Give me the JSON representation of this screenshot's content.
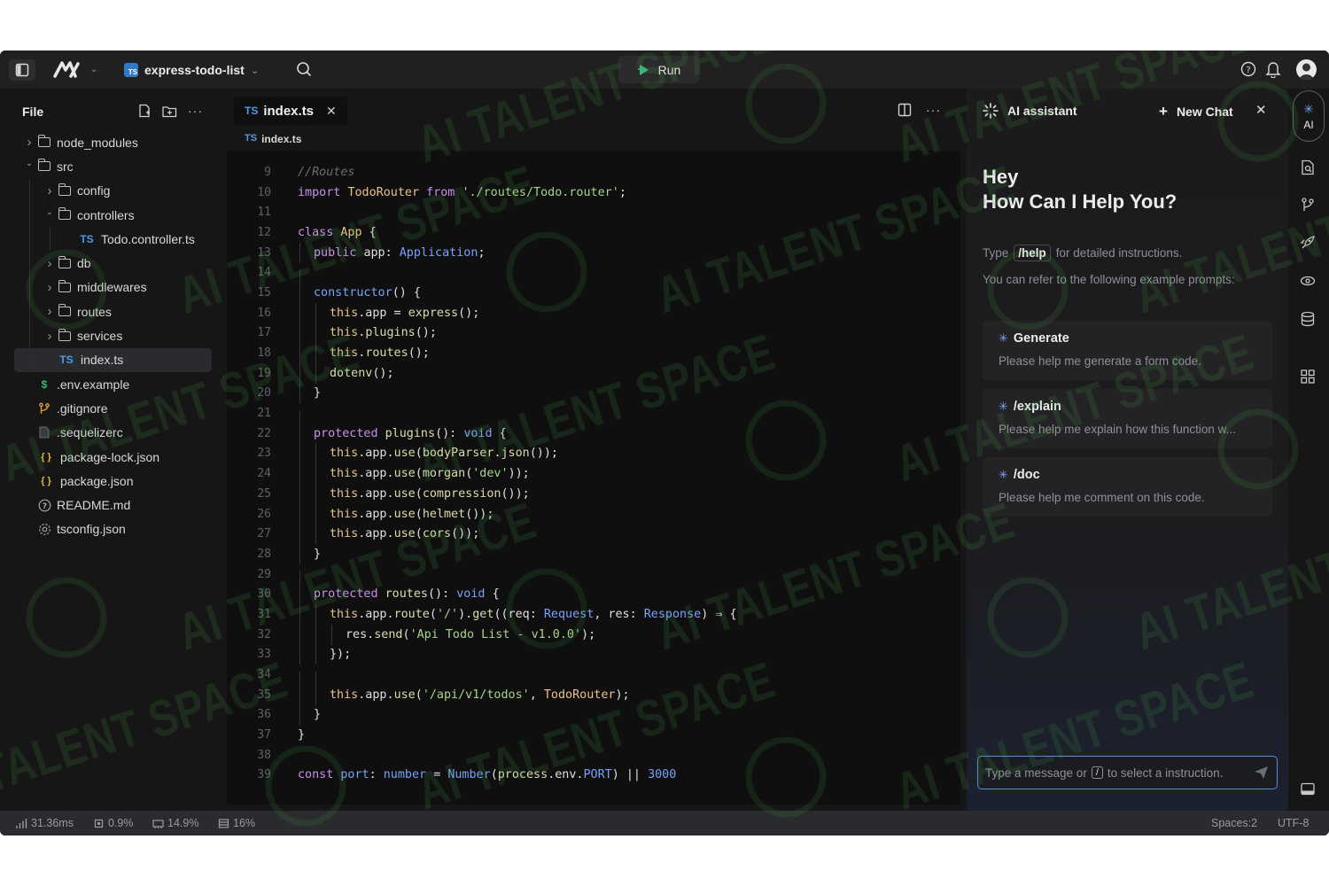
{
  "topbar": {
    "project_name": "express-todo-list",
    "run_label": "Run"
  },
  "explorer": {
    "title": "File",
    "tree": [
      {
        "label": "node_modules",
        "type": "folder",
        "depth": 0,
        "expanded": false
      },
      {
        "label": "src",
        "type": "folder",
        "depth": 0,
        "expanded": true
      },
      {
        "label": "config",
        "type": "folder",
        "depth": 1,
        "expanded": false
      },
      {
        "label": "controllers",
        "type": "folder",
        "depth": 1,
        "expanded": true
      },
      {
        "label": "Todo.controller.ts",
        "type": "ts",
        "depth": 2
      },
      {
        "label": "db",
        "type": "folder",
        "depth": 1,
        "expanded": false
      },
      {
        "label": "middlewares",
        "type": "folder",
        "depth": 1,
        "expanded": false
      },
      {
        "label": "routes",
        "type": "folder",
        "depth": 1,
        "expanded": false
      },
      {
        "label": "services",
        "type": "folder",
        "depth": 1,
        "expanded": false
      },
      {
        "label": "index.ts",
        "type": "ts",
        "depth": 1,
        "selected": true
      },
      {
        "label": ".env.example",
        "type": "env",
        "depth": 0
      },
      {
        "label": ".gitignore",
        "type": "git",
        "depth": 0
      },
      {
        "label": ".sequelizerc",
        "type": "file",
        "depth": 0
      },
      {
        "label": "package-lock.json",
        "type": "json",
        "depth": 0
      },
      {
        "label": "package.json",
        "type": "json",
        "depth": 0
      },
      {
        "label": "README.md",
        "type": "readme",
        "depth": 0
      },
      {
        "label": "tsconfig.json",
        "type": "config",
        "depth": 0
      }
    ]
  },
  "editor": {
    "tab": {
      "badge": "TS",
      "label": "index.ts"
    },
    "breadcrumb": {
      "badge": "TS",
      "label": "index.ts"
    },
    "lines": [
      {
        "n": "9",
        "indent": 0,
        "tokens": [
          [
            "cm",
            "//Routes"
          ]
        ]
      },
      {
        "n": "10",
        "indent": 0,
        "tokens": [
          [
            "kw",
            "import "
          ],
          [
            "cls",
            "TodoRouter "
          ],
          [
            "kw",
            "from "
          ],
          [
            "st",
            "'./routes/Todo.router'"
          ],
          [
            "pr",
            ";"
          ]
        ]
      },
      {
        "n": "11",
        "indent": 0,
        "tokens": []
      },
      {
        "n": "12",
        "indent": 0,
        "tokens": [
          [
            "kw",
            "class "
          ],
          [
            "cls",
            "App "
          ],
          [
            "pr",
            "{"
          ]
        ]
      },
      {
        "n": "13",
        "indent": 1,
        "tokens": [
          [
            "kw",
            "public "
          ],
          [
            "pr",
            "app: "
          ],
          [
            "ty",
            "Application"
          ],
          [
            "pr",
            ";"
          ]
        ]
      },
      {
        "n": "14",
        "indent": 1,
        "tokens": []
      },
      {
        "n": "15",
        "indent": 1,
        "tokens": [
          [
            "nm",
            "constructor"
          ],
          [
            "pr",
            "() {"
          ]
        ]
      },
      {
        "n": "16",
        "indent": 2,
        "tokens": [
          [
            "th",
            "this"
          ],
          [
            "pr",
            ".app = "
          ],
          [
            "fn",
            "express"
          ],
          [
            "pr",
            "();"
          ]
        ]
      },
      {
        "n": "17",
        "indent": 2,
        "tokens": [
          [
            "th",
            "this"
          ],
          [
            "pr",
            "."
          ],
          [
            "fn",
            "plugins"
          ],
          [
            "pr",
            "();"
          ]
        ]
      },
      {
        "n": "18",
        "indent": 2,
        "tokens": [
          [
            "th",
            "this"
          ],
          [
            "pr",
            "."
          ],
          [
            "fn",
            "routes"
          ],
          [
            "pr",
            "();"
          ]
        ]
      },
      {
        "n": "19",
        "indent": 2,
        "tokens": [
          [
            "fn",
            "dotenv"
          ],
          [
            "pr",
            "();"
          ]
        ]
      },
      {
        "n": "20",
        "indent": 1,
        "tokens": [
          [
            "pr",
            "}"
          ]
        ]
      },
      {
        "n": "21",
        "indent": 1,
        "tokens": []
      },
      {
        "n": "22",
        "indent": 1,
        "tokens": [
          [
            "kw",
            "protected "
          ],
          [
            "fn",
            "plugins"
          ],
          [
            "pr",
            "(): "
          ],
          [
            "ty",
            "void "
          ],
          [
            "pr",
            "{"
          ]
        ]
      },
      {
        "n": "23",
        "indent": 2,
        "tokens": [
          [
            "th",
            "this"
          ],
          [
            "pr",
            ".app."
          ],
          [
            "fn",
            "use"
          ],
          [
            "pr",
            "("
          ],
          [
            "fn",
            "bodyParser"
          ],
          [
            "pr",
            "."
          ],
          [
            "fn",
            "json"
          ],
          [
            "pr",
            "());"
          ]
        ]
      },
      {
        "n": "24",
        "indent": 2,
        "tokens": [
          [
            "th",
            "this"
          ],
          [
            "pr",
            ".app."
          ],
          [
            "fn",
            "use"
          ],
          [
            "pr",
            "("
          ],
          [
            "fn",
            "morgan"
          ],
          [
            "pr",
            "("
          ],
          [
            "st",
            "'dev'"
          ],
          [
            "pr",
            "));"
          ]
        ]
      },
      {
        "n": "25",
        "indent": 2,
        "tokens": [
          [
            "th",
            "this"
          ],
          [
            "pr",
            ".app."
          ],
          [
            "fn",
            "use"
          ],
          [
            "pr",
            "("
          ],
          [
            "fn",
            "compression"
          ],
          [
            "pr",
            "());"
          ]
        ]
      },
      {
        "n": "26",
        "indent": 2,
        "tokens": [
          [
            "th",
            "this"
          ],
          [
            "pr",
            ".app."
          ],
          [
            "fn",
            "use"
          ],
          [
            "pr",
            "("
          ],
          [
            "fn",
            "helmet"
          ],
          [
            "pr",
            "());"
          ]
        ]
      },
      {
        "n": "27",
        "indent": 2,
        "tokens": [
          [
            "th",
            "this"
          ],
          [
            "pr",
            ".app."
          ],
          [
            "fn",
            "use"
          ],
          [
            "pr",
            "("
          ],
          [
            "fn",
            "cors"
          ],
          [
            "pr",
            "());"
          ]
        ]
      },
      {
        "n": "28",
        "indent": 1,
        "tokens": [
          [
            "pr",
            "}"
          ]
        ]
      },
      {
        "n": "29",
        "indent": 1,
        "tokens": []
      },
      {
        "n": "30",
        "indent": 1,
        "tokens": [
          [
            "kw",
            "protected "
          ],
          [
            "fn",
            "routes"
          ],
          [
            "pr",
            "(): "
          ],
          [
            "ty",
            "void "
          ],
          [
            "pr",
            "{"
          ]
        ]
      },
      {
        "n": "31",
        "indent": 2,
        "tokens": [
          [
            "th",
            "this"
          ],
          [
            "pr",
            ".app."
          ],
          [
            "fn",
            "route"
          ],
          [
            "pr",
            "("
          ],
          [
            "st",
            "'/'"
          ],
          [
            "pr",
            ")."
          ],
          [
            "fn",
            "get"
          ],
          [
            "pr",
            "((req: "
          ],
          [
            "ty",
            "Request"
          ],
          [
            "pr",
            ", res: "
          ],
          [
            "ty",
            "Response"
          ],
          [
            "pr",
            ") ⇒ {"
          ]
        ]
      },
      {
        "n": "32",
        "indent": 3,
        "tokens": [
          [
            "pr",
            "res."
          ],
          [
            "fn",
            "send"
          ],
          [
            "pr",
            "("
          ],
          [
            "st",
            "'Api Todo List - v1.0.0'"
          ],
          [
            "pr",
            ");"
          ]
        ]
      },
      {
        "n": "33",
        "indent": 2,
        "tokens": [
          [
            "pr",
            "});"
          ]
        ]
      },
      {
        "n": "34",
        "indent": 2,
        "tokens": []
      },
      {
        "n": "35",
        "indent": 2,
        "tokens": [
          [
            "th",
            "this"
          ],
          [
            "pr",
            ".app."
          ],
          [
            "fn",
            "use"
          ],
          [
            "pr",
            "("
          ],
          [
            "st",
            "'/api/v1/todos'"
          ],
          [
            "pr",
            ", "
          ],
          [
            "cls",
            "TodoRouter"
          ],
          [
            "pr",
            ");"
          ]
        ]
      },
      {
        "n": "36",
        "indent": 1,
        "tokens": [
          [
            "pr",
            "}"
          ]
        ]
      },
      {
        "n": "37",
        "indent": 0,
        "tokens": [
          [
            "pr",
            "}"
          ]
        ]
      },
      {
        "n": "38",
        "indent": 0,
        "tokens": []
      },
      {
        "n": "39",
        "indent": 0,
        "tokens": [
          [
            "kw",
            "const "
          ],
          [
            "nm",
            "port"
          ],
          [
            "pr",
            ": "
          ],
          [
            "ty",
            "number "
          ],
          [
            "pr",
            "= "
          ],
          [
            "ty",
            "Number"
          ],
          [
            "pr",
            "("
          ],
          [
            "fn",
            "process"
          ],
          [
            "pr",
            ".env."
          ],
          [
            "nm",
            "PORT"
          ],
          [
            "pr",
            ") || "
          ],
          [
            "nm",
            "3000"
          ]
        ]
      }
    ]
  },
  "ai": {
    "title": "AI assistant",
    "new_chat": "New Chat",
    "greeting_1": "Hey",
    "greeting_2": "How Can I Help You?",
    "help_prefix": "Type",
    "help_chip": "/help",
    "help_suffix": "for detailed instructions.",
    "refer": "You can refer to the following example prompts:",
    "cards": [
      {
        "title": "Generate",
        "desc": "Please help me generate a form code."
      },
      {
        "title": "/explain",
        "desc": "Please help me explain how this function w..."
      },
      {
        "title": "/doc",
        "desc": "Please help me comment on this code."
      }
    ],
    "input_prefix": "Type a message or",
    "input_slash": "/",
    "input_suffix": "to select a instruction."
  },
  "rail": {
    "ai_label": "AI"
  },
  "status": {
    "latency": "31.36ms",
    "cpu": "0.9%",
    "memory": "14.9%",
    "disk": "16%",
    "spaces": "Spaces:2",
    "encoding": "UTF-8"
  },
  "watermark": "AI TALENT SPACE",
  "colors": {
    "accent": "#3178c6",
    "focus": "#5a8fd8"
  }
}
